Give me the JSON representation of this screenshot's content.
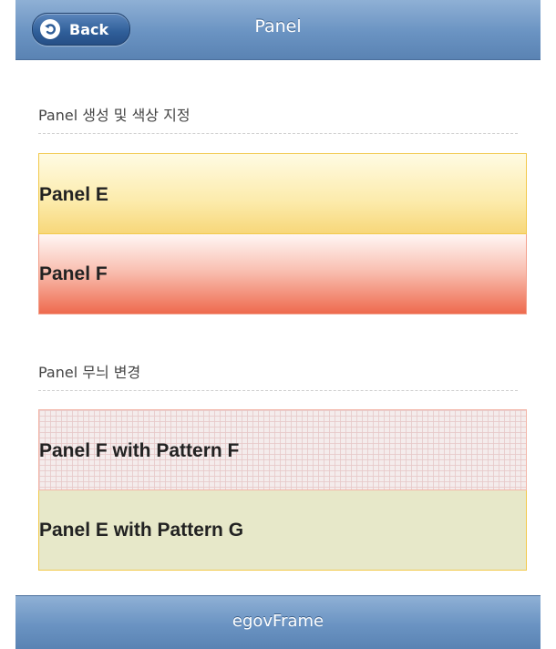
{
  "header": {
    "title": "Panel",
    "back_label": "Back",
    "back_icon": "undo-arrow-icon"
  },
  "sections": [
    {
      "title": "Panel 생성 및 색상 지정",
      "panels": [
        {
          "label": "Panel E",
          "theme": "e",
          "color": "#fcebab"
        },
        {
          "label": "Panel F",
          "theme": "f",
          "color": "#ee6a4e"
        }
      ]
    },
    {
      "title": "Panel 무늬 변경",
      "panels": [
        {
          "label": "Panel F with Pattern F",
          "theme": "f-pattern-f",
          "color": "#f4ecec"
        },
        {
          "label": "Panel E with Pattern G",
          "theme": "e-pattern-g",
          "color": "#e7e8c9"
        }
      ]
    }
  ],
  "footer": {
    "text": "egovFrame"
  },
  "colors": {
    "bar_gradient_top": "#8fb0d5",
    "bar_gradient_bottom": "#5a83b3",
    "back_button": "#2f5e99"
  }
}
